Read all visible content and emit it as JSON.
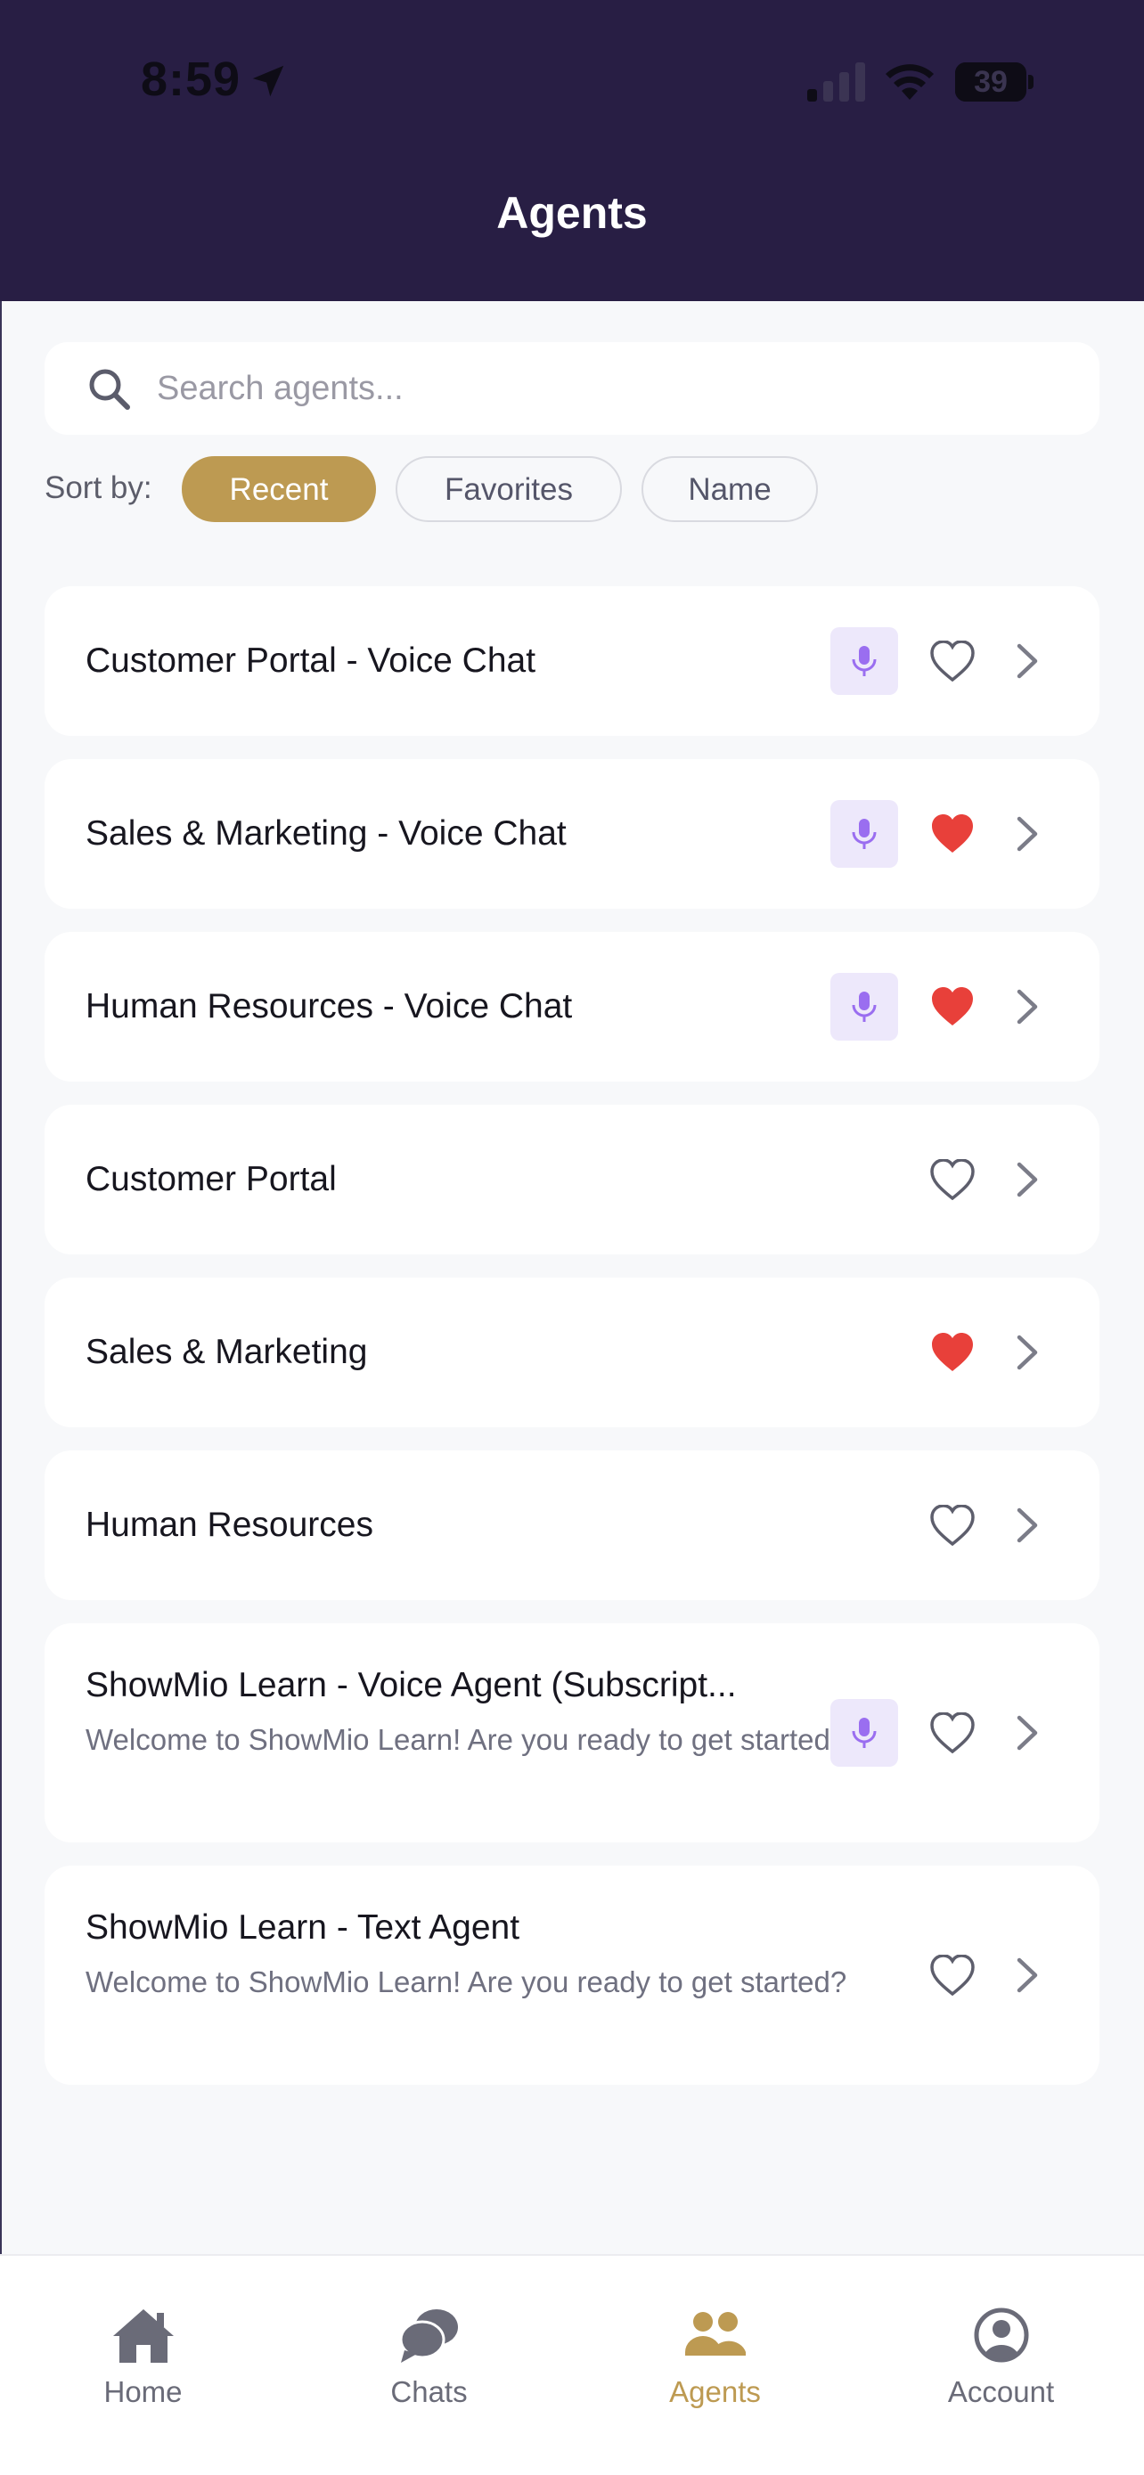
{
  "status_bar": {
    "time": "8:59",
    "battery": "39"
  },
  "header": {
    "title": "Agents"
  },
  "search": {
    "placeholder": "Search agents...",
    "value": ""
  },
  "sort": {
    "label": "Sort by:",
    "options": [
      {
        "label": "Recent",
        "active": true
      },
      {
        "label": "Favorites",
        "active": false
      },
      {
        "label": "Name",
        "active": false
      }
    ]
  },
  "agents": [
    {
      "title": "Customer Portal - Voice Chat",
      "description": "",
      "voice": true,
      "favorite": false
    },
    {
      "title": "Sales & Marketing - Voice Chat",
      "description": "",
      "voice": true,
      "favorite": true
    },
    {
      "title": "Human Resources - Voice Chat",
      "description": "",
      "voice": true,
      "favorite": true
    },
    {
      "title": "Customer Portal",
      "description": "",
      "voice": false,
      "favorite": false
    },
    {
      "title": "Sales & Marketing",
      "description": "",
      "voice": false,
      "favorite": true
    },
    {
      "title": "Human Resources",
      "description": "",
      "voice": false,
      "favorite": false
    },
    {
      "title": "ShowMio Learn - Voice Agent (Subscript...",
      "description": "Welcome to ShowMio Learn! Are you ready to get started?",
      "voice": true,
      "favorite": false
    },
    {
      "title": "ShowMio Learn - Text Agent",
      "description": "Welcome to ShowMio Learn! Are you ready to get started?",
      "voice": false,
      "favorite": false
    }
  ],
  "nav": {
    "items": [
      {
        "label": "Home",
        "icon": "home-icon",
        "active": false
      },
      {
        "label": "Chats",
        "icon": "chat-bubbles-icon",
        "active": false
      },
      {
        "label": "Agents",
        "icon": "users-icon",
        "active": true
      },
      {
        "label": "Account",
        "icon": "user-circle-icon",
        "active": false
      }
    ]
  },
  "colors": {
    "header_bg": "#281e44",
    "accent_gold": "#bd9a52",
    "heart_red": "#e8403a",
    "mic_purple": "#9a6ef0",
    "mic_badge_bg": "#ede8fb"
  }
}
